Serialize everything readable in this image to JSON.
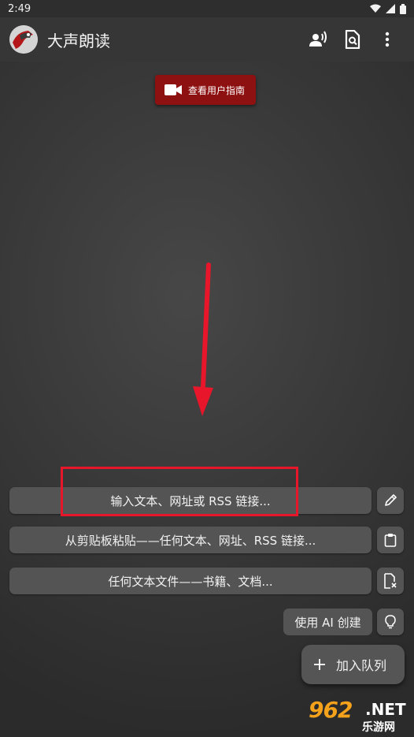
{
  "status_bar": {
    "time": "2:49"
  },
  "app_bar": {
    "title": "大声朗读"
  },
  "guide_button": {
    "label": "查看用户指南"
  },
  "actions": {
    "input_text": "输入文本、网址或 RSS 链接...",
    "paste_clipboard": "从剪贴板粘贴——任何文本、网址、RSS 链接...",
    "any_file": "任何文本文件——书籍、文档...",
    "ai_create": "使用 AI 创建"
  },
  "fab": {
    "label": "加入队列"
  },
  "watermark": {
    "number": "962",
    "net": ".NET",
    "sub": "乐游网"
  },
  "colors": {
    "accent_red": "#8e1111",
    "highlight_red": "#e8162a",
    "button_bg": "#545454",
    "watermark_orange": "#f4a21b"
  }
}
